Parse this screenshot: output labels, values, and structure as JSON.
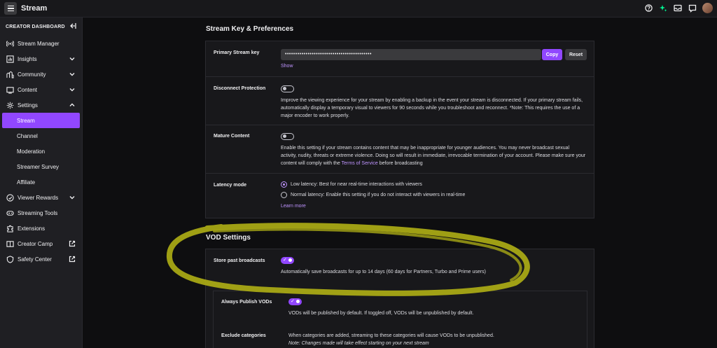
{
  "header": {
    "title": "Stream"
  },
  "sidebar": {
    "heading": "CREATOR DASHBOARD",
    "items": [
      {
        "label": "Stream Manager",
        "icon": "broadcast-icon"
      },
      {
        "label": "Insights",
        "icon": "insights-icon"
      },
      {
        "label": "Community",
        "icon": "community-icon"
      },
      {
        "label": "Content",
        "icon": "content-icon"
      },
      {
        "label": "Settings",
        "icon": "gear-icon"
      }
    ],
    "settings_sub": [
      "Stream",
      "Channel",
      "Moderation",
      "Streamer Survey",
      "Affiliate"
    ],
    "bottom_items": [
      {
        "label": "Viewer Rewards",
        "icon": "rewards-icon"
      },
      {
        "label": "Streaming Tools",
        "icon": "tools-icon"
      },
      {
        "label": "Extensions",
        "icon": "extensions-icon"
      },
      {
        "label": "Creator Camp",
        "icon": "camp-icon"
      },
      {
        "label": "Safety Center",
        "icon": "safety-icon"
      }
    ]
  },
  "stream_key": {
    "section_title": "Stream Key & Preferences",
    "primary_label": "Primary Stream key",
    "key_value": "••••••••••••••••••••••••••••••••••••••••••",
    "copy_label": "Copy",
    "reset_label": "Reset",
    "show_label": "Show",
    "disconnect_label": "Disconnect Protection",
    "disconnect_text": "Improve the viewing experience for your stream by enabling a backup in the event your stream is disconnected. If your primary stream fails, automatically display a temporary visual to viewers for 90 seconds while you troubleshoot and reconnect. *Note: This requires the use of a major encoder to work properly.",
    "mature_label": "Mature Content",
    "mature_text_pre": "Enable this setting if your stream contains content that may be inappropriate for younger audiences. You may never broadcast sexual activity, nudity, threats or extreme violence. Doing so will result in immediate, irrevocable termination of your account. Please make sure your content will comply with the ",
    "mature_link": "Terms of Service",
    "mature_text_post": " before broadcasting",
    "latency_label": "Latency mode",
    "latency_low": "Low latency: Best for near real-time interactions with viewers",
    "latency_normal": "Normal latency: Enable this setting if you do not interact with viewers in real-time",
    "learn_more": "Learn more"
  },
  "vod": {
    "section_title": "VOD Settings",
    "store_label": "Store past broadcasts",
    "store_text": "Automatically save broadcasts for up to 14 days (60 days for Partners, Turbo and Prime users)",
    "publish_label": "Always Publish VODs",
    "publish_text": "VODs will be published by default. If toggled off, VODs will be unpublished by default.",
    "exclude_label": "Exclude categories",
    "exclude_text": "When categories are added, streaming to these categories will cause VODs to be unpublished.",
    "exclude_note": "Note: Changes made will take effect starting on your next stream"
  },
  "colors": {
    "accent": "#9147ff",
    "highlight_marker": "#a8a815"
  }
}
